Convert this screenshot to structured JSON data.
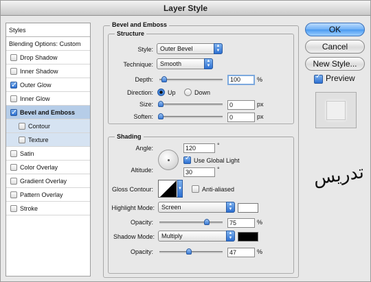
{
  "window": {
    "title": "Layer Style"
  },
  "styles_panel": {
    "header": "Styles",
    "blending": "Blending Options: Custom",
    "items": [
      {
        "label": "Drop Shadow",
        "checked": false
      },
      {
        "label": "Inner Shadow",
        "checked": false
      },
      {
        "label": "Outer Glow",
        "checked": true
      },
      {
        "label": "Inner Glow",
        "checked": false
      },
      {
        "label": "Bevel and Emboss",
        "checked": true,
        "selected": true
      },
      {
        "label": "Contour",
        "checked": false,
        "sub": true
      },
      {
        "label": "Texture",
        "checked": false,
        "sub": true
      },
      {
        "label": "Satin",
        "checked": false
      },
      {
        "label": "Color Overlay",
        "checked": false
      },
      {
        "label": "Gradient Overlay",
        "checked": false
      },
      {
        "label": "Pattern Overlay",
        "checked": false
      },
      {
        "label": "Stroke",
        "checked": false
      }
    ]
  },
  "bevel": {
    "title": "Bevel and Emboss",
    "structure": {
      "title": "Structure",
      "style_label": "Style:",
      "style_value": "Outer Bevel",
      "technique_label": "Technique:",
      "technique_value": "Smooth",
      "depth_label": "Depth:",
      "depth_value": "100",
      "depth_level": 100,
      "depth_unit": "%",
      "direction_label": "Direction:",
      "direction_up": "Up",
      "direction_down": "Down",
      "size_label": "Size:",
      "size_value": "0",
      "size_unit": "px",
      "soften_label": "Soften:",
      "soften_value": "0",
      "soften_unit": "px"
    },
    "shading": {
      "title": "Shading",
      "angle_label": "Angle:",
      "angle_value": "120",
      "degree": "°",
      "global_light_label": "Use Global Light",
      "altitude_label": "Altitude:",
      "altitude_value": "30",
      "gloss_label": "Gloss Contour:",
      "anti_aliased_label": "Anti-aliased",
      "highlight_mode_label": "Highlight Mode:",
      "highlight_mode_value": "Screen",
      "highlight_color": "#ffffff",
      "highlight_opacity_label": "Opacity:",
      "highlight_opacity_value": "75",
      "shadow_mode_label": "Shadow Mode:",
      "shadow_mode_value": "Multiply",
      "shadow_color": "#000000",
      "shadow_opacity_label": "Opacity:",
      "shadow_opacity_value": "47",
      "percent": "%"
    }
  },
  "buttons": {
    "ok": "OK",
    "cancel": "Cancel",
    "new_style": "New Style...",
    "preview": "Preview"
  },
  "watermark": {
    "text": "تدریس"
  }
}
